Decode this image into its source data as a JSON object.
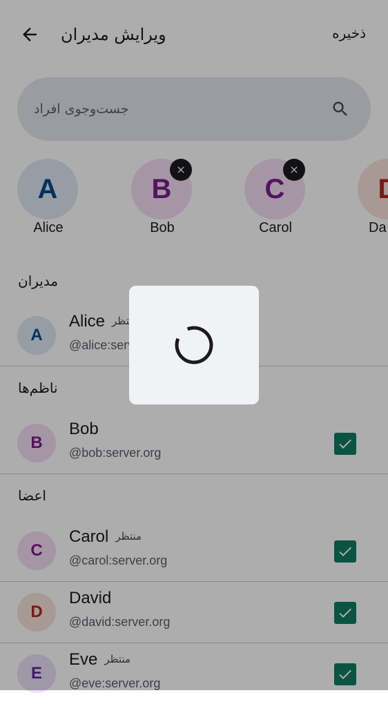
{
  "topbar": {
    "title": "ویرایش مدیران",
    "save_label": "ذخیره",
    "back_icon": "arrow-back-icon"
  },
  "search": {
    "placeholder": "جست‌وجوی افراد",
    "icon": "search-icon"
  },
  "selected": [
    {
      "initial": "A",
      "name": "Alice",
      "removable": false,
      "color": "#0a4a86",
      "bg": "#dde8f3"
    },
    {
      "initial": "B",
      "name": "Bob",
      "removable": true,
      "color": "#7d1d8c",
      "bg": "#f3def5"
    },
    {
      "initial": "C",
      "name": "Carol",
      "removable": true,
      "color": "#7d1d8c",
      "bg": "#f3def5"
    },
    {
      "initial": "D",
      "name": "Da",
      "removable": false,
      "color": "#b3261e",
      "bg": "#f8e2da"
    }
  ],
  "sections": {
    "admins": "مدیران",
    "moderators": "ناظم‌ها",
    "members": "اعضا"
  },
  "rows": [
    {
      "initial": "A",
      "name": "Alice",
      "pending": "منتظر",
      "handle": "@alice:server.org",
      "checked": false,
      "color": "#0a4a86",
      "bg": "#dde8f3"
    },
    {
      "initial": "B",
      "name": "Bob",
      "pending": "",
      "handle": "@bob:server.org",
      "checked": true,
      "color": "#7d1d8c",
      "bg": "#f3def5"
    },
    {
      "initial": "C",
      "name": "Carol",
      "pending": "منتظر",
      "handle": "@carol:server.org",
      "checked": true,
      "color": "#7d1d8c",
      "bg": "#f3def5"
    },
    {
      "initial": "D",
      "name": "David",
      "pending": "",
      "handle": "@david:server.org",
      "checked": true,
      "color": "#b3261e",
      "bg": "#f8e2da"
    },
    {
      "initial": "E",
      "name": "Eve",
      "pending": "منتظر",
      "handle": "@eve:server.org",
      "checked": true,
      "color": "#5b2a9e",
      "bg": "#e9e0f7"
    }
  ],
  "dialog": {
    "state": "loading",
    "icon": "spinner-icon"
  },
  "colors": {
    "check": "#0f7c62",
    "scrim": "rgba(0,0,0,0.32)",
    "dialog_bg": "#f1f2f6"
  }
}
